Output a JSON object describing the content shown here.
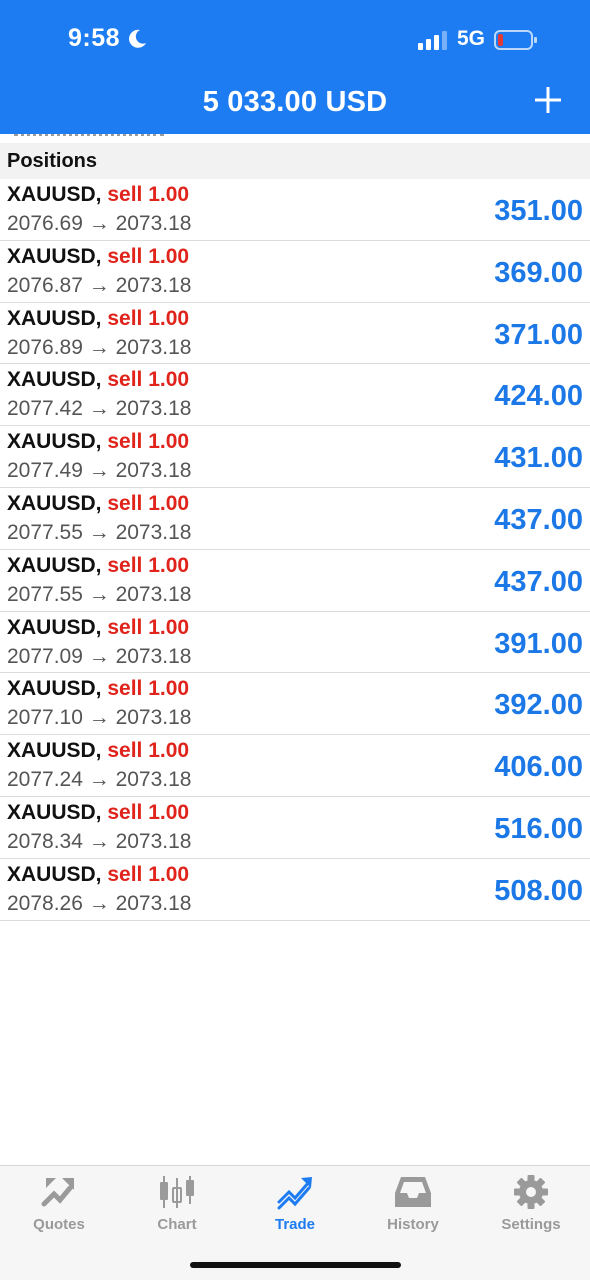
{
  "status_bar": {
    "time": "9:58",
    "network": "5G",
    "icons": [
      "moon-icon",
      "signal-icon",
      "battery-low-icon"
    ]
  },
  "header": {
    "balance": "5 033.00 USD",
    "add_icon": "plus-icon"
  },
  "section": {
    "title": "Positions"
  },
  "colors": {
    "accent": "#1d7cf2",
    "profit": "#1b78e6",
    "sell": "#e0241c"
  },
  "positions": [
    {
      "symbol": "XAUUSD,",
      "side": "sell 1.00",
      "prices": "2076.69 → 2073.18",
      "profit": "351.00"
    },
    {
      "symbol": "XAUUSD,",
      "side": "sell 1.00",
      "prices": "2076.87 → 2073.18",
      "profit": "369.00"
    },
    {
      "symbol": "XAUUSD,",
      "side": "sell 1.00",
      "prices": "2076.89 → 2073.18",
      "profit": "371.00"
    },
    {
      "symbol": "XAUUSD,",
      "side": "sell 1.00",
      "prices": "2077.42 → 2073.18",
      "profit": "424.00"
    },
    {
      "symbol": "XAUUSD,",
      "side": "sell 1.00",
      "prices": "2077.49 → 2073.18",
      "profit": "431.00"
    },
    {
      "symbol": "XAUUSD,",
      "side": "sell 1.00",
      "prices": "2077.55 → 2073.18",
      "profit": "437.00"
    },
    {
      "symbol": "XAUUSD,",
      "side": "sell 1.00",
      "prices": "2077.55 → 2073.18",
      "profit": "437.00"
    },
    {
      "symbol": "XAUUSD,",
      "side": "sell 1.00",
      "prices": "2077.09 → 2073.18",
      "profit": "391.00"
    },
    {
      "symbol": "XAUUSD,",
      "side": "sell 1.00",
      "prices": "2077.10 → 2073.18",
      "profit": "392.00"
    },
    {
      "symbol": "XAUUSD,",
      "side": "sell 1.00",
      "prices": "2077.24 → 2073.18",
      "profit": "406.00"
    },
    {
      "symbol": "XAUUSD,",
      "side": "sell 1.00",
      "prices": "2078.34 → 2073.18",
      "profit": "516.00"
    },
    {
      "symbol": "XAUUSD,",
      "side": "sell 1.00",
      "prices": "2078.26 → 2073.18",
      "profit": "508.00"
    }
  ],
  "tabbar": {
    "tabs": [
      {
        "label": "Quotes",
        "icon": "quotes-icon",
        "active": false
      },
      {
        "label": "Chart",
        "icon": "candlestick-icon",
        "active": false
      },
      {
        "label": "Trade",
        "icon": "trade-icon",
        "active": true
      },
      {
        "label": "History",
        "icon": "inbox-icon",
        "active": false
      },
      {
        "label": "Settings",
        "icon": "gear-icon",
        "active": false
      }
    ]
  }
}
